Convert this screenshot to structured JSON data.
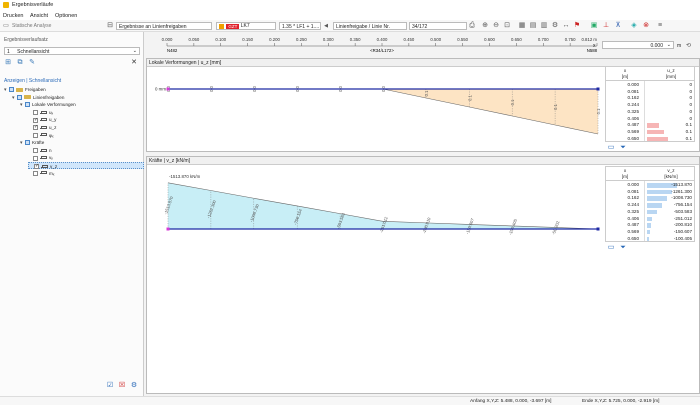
{
  "window": {
    "title": "Ergebnisverläufe"
  },
  "menu": [
    "Drucken",
    "Ansicht",
    "Optionen"
  ],
  "toolbar": {
    "static_label": "Statische Analyse",
    "results_combo": "Ergebnisse an Linienfreigaben",
    "lc_badge": "GZT",
    "lc_name": "LK7",
    "lc_combo": "1.35 * LF1 + 1....",
    "release_label": "Linienfreigabe / Linie Nr.",
    "release_value": "34/172"
  },
  "left_panel": {
    "heading": "Ergebnisverlaufsatz",
    "set_index": "1",
    "set_name": "Schnellansicht",
    "nav_heading": "Anzeigen | Schnellansicht",
    "tree": [
      {
        "label": "Freigaben",
        "level": 0,
        "state": "part",
        "expanded": true,
        "icon": "folder-icon"
      },
      {
        "label": "Linienfreigaben",
        "level": 1,
        "state": "part",
        "expanded": true,
        "icon": "folder-icon"
      },
      {
        "label": "Lokale Verformungen",
        "level": 2,
        "state": "part",
        "expanded": true,
        "icon": "none"
      },
      {
        "label": "uₓ",
        "level": 3,
        "state": "off",
        "icon": "member-icon"
      },
      {
        "label": "u_y",
        "level": 3,
        "state": "on",
        "icon": "member-icon"
      },
      {
        "label": "u_z",
        "level": 3,
        "state": "on",
        "icon": "member-icon"
      },
      {
        "label": "φₓ",
        "level": 3,
        "state": "off",
        "icon": "member-icon"
      },
      {
        "label": "Kräfte",
        "level": 2,
        "state": "part",
        "expanded": true,
        "icon": "none"
      },
      {
        "label": "n",
        "level": 3,
        "state": "off",
        "icon": "member-icon"
      },
      {
        "label": "vᵧ",
        "level": 3,
        "state": "off",
        "icon": "member-icon"
      },
      {
        "label": "v_z",
        "level": 3,
        "state": "on",
        "icon": "member-icon",
        "selected": true
      },
      {
        "label": "mₓ",
        "level": 3,
        "state": "off",
        "icon": "member-icon"
      }
    ]
  },
  "axis": {
    "ticks": [
      "0.000",
      "0.050",
      "0.100",
      "0.150",
      "0.200",
      "0.250",
      "0.300",
      "0.350",
      "0.400",
      "0.450",
      "0.500",
      "0.550",
      "0.600",
      "0.650",
      "0.700",
      "0.750",
      "0.812 m"
    ],
    "start_node": "N482",
    "end_node": "N588",
    "mid_label": "<R34/L172>",
    "x_label": "x",
    "x_value": "0.000",
    "x_unit": "m"
  },
  "chart_data": [
    {
      "type": "area",
      "title": "Lokale Verformungen | u_z [mm]",
      "x": [
        0.0,
        0.081,
        0.162,
        0.244,
        0.325,
        0.406,
        0.487,
        0.569,
        0.65,
        0.731,
        0.812
      ],
      "labels": [
        "0.0",
        "0.0",
        "0.0",
        "0.0",
        "0.0",
        "0.0",
        "0.1",
        "0.1",
        "0.1",
        "0.1",
        "0.1"
      ],
      "series": [
        {
          "values": [
            0.0,
            0.0,
            0.0,
            0.0,
            0.0,
            0.0,
            0.02,
            0.04,
            0.06,
            0.08,
            0.1
          ]
        }
      ],
      "y_text": "0 mm",
      "fill": "#fde4c4",
      "line": "#1f2aa5"
    },
    {
      "type": "area",
      "title": "Kräfte | v_z [kN/m]",
      "x": [
        0.0,
        0.081,
        0.162,
        0.244,
        0.325,
        0.406,
        0.487,
        0.569,
        0.65,
        0.731,
        0.812
      ],
      "labels": [
        "-1513.870",
        "-1262.300",
        "-1008.730",
        "-756.154",
        "-503.583",
        "-251.012",
        "-200.810",
        "-150.607",
        "-100.405",
        "-50.202",
        ""
      ],
      "series": [
        {
          "values": [
            -1513.87,
            -1262.3,
            -1008.73,
            -756.154,
            -503.583,
            -251.012,
            -200.81,
            -150.607,
            -100.405,
            -50.202,
            0.0
          ]
        }
      ],
      "y_text": "-1513.870 kN/m",
      "fill": "#c8eef6",
      "line": "#1f2aa5"
    }
  ],
  "table1": {
    "col_x": "x",
    "col_x_unit": "[m]",
    "col_v": "u_z",
    "col_v_unit": "[mm]",
    "rows": [
      {
        "x": "0.000",
        "v": "0",
        "bar": 0.0
      },
      {
        "x": "0.081",
        "v": "0",
        "bar": 0.0
      },
      {
        "x": "0.162",
        "v": "0",
        "bar": 0.0
      },
      {
        "x": "0.244",
        "v": "0",
        "bar": 0.0
      },
      {
        "x": "0.325",
        "v": "0",
        "bar": 0.0
      },
      {
        "x": "0.406",
        "v": "0",
        "bar": 0.0
      },
      {
        "x": "0.487",
        "v": "0.1",
        "bar": 0.4
      },
      {
        "x": "0.569",
        "v": "0.1",
        "bar": 0.55
      },
      {
        "x": "0.650",
        "v": "0.1",
        "bar": 0.7
      }
    ]
  },
  "table2": {
    "col_x": "x",
    "col_x_unit": "[m]",
    "col_v": "v_z",
    "col_v_unit": "[kN/m]",
    "rows": [
      {
        "x": "0.000",
        "v": "-1513.870",
        "bar": 1.0
      },
      {
        "x": "0.081",
        "v": "-1261.300",
        "bar": 0.83
      },
      {
        "x": "0.162",
        "v": "-1008.730",
        "bar": 0.67
      },
      {
        "x": "0.244",
        "v": "-756.154",
        "bar": 0.5
      },
      {
        "x": "0.325",
        "v": "-503.583",
        "bar": 0.33
      },
      {
        "x": "0.406",
        "v": "-251.012",
        "bar": 0.17
      },
      {
        "x": "0.487",
        "v": "-200.810",
        "bar": 0.13
      },
      {
        "x": "0.569",
        "v": "-150.607",
        "bar": 0.1
      },
      {
        "x": "0.650",
        "v": "-100.405",
        "bar": 0.07
      }
    ]
  },
  "status": {
    "start": "Anfang X,Y,Z: 5.488, 0.000, -3.697 [m]",
    "end": "Ende X,Y,Z: 5.725, 0.000, -2.919 [m]"
  }
}
